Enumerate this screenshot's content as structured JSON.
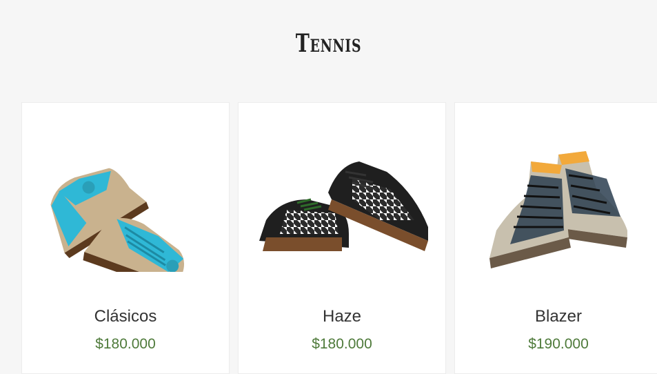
{
  "section": {
    "title": "Tennis"
  },
  "products": [
    {
      "name": "Clásicos",
      "price": "$180.000",
      "image": "turquoise-woven-sneakers-image"
    },
    {
      "name": "Haze",
      "price": "$180.000",
      "image": "black-houndstooth-sneakers-image"
    },
    {
      "name": "Blazer",
      "price": "$190.000",
      "image": "navy-high-top-sneakers-image"
    }
  ],
  "colors": {
    "page_background": "#f6f6f6",
    "card_background": "#ffffff",
    "price_color": "#4e7a3a",
    "title_color": "#222222"
  }
}
